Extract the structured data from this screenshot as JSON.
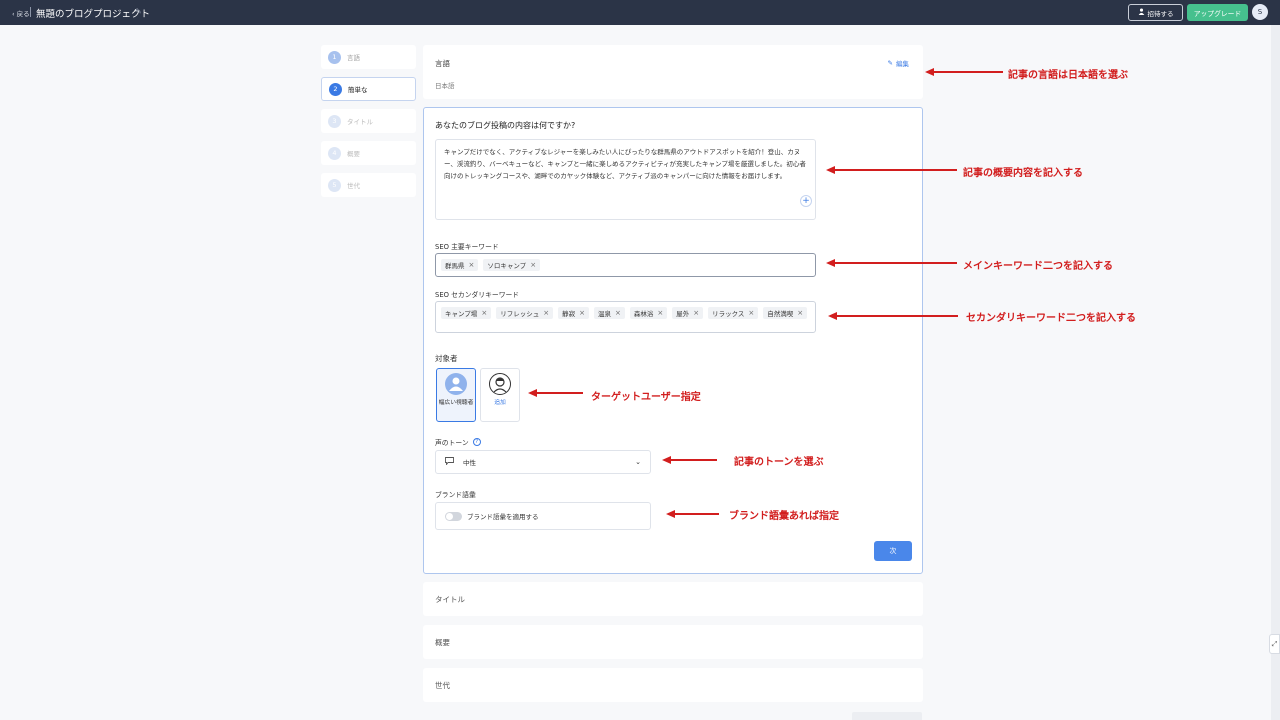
{
  "topbar": {
    "back_label": "‹ 戻る",
    "project_title": "無題のブログプロジェクト",
    "invite_label": "招待する",
    "upgrade_label": "アップグレード",
    "avatar_initial": "S"
  },
  "steps": [
    {
      "num": "1",
      "label": "言語",
      "state": "done"
    },
    {
      "num": "2",
      "label": "簡単な",
      "state": "active"
    },
    {
      "num": "3",
      "label": "タイトル",
      "state": "todo"
    },
    {
      "num": "4",
      "label": "概要",
      "state": "todo"
    },
    {
      "num": "5",
      "label": "世代",
      "state": "todo"
    }
  ],
  "language_card": {
    "label": "言語",
    "value": "日本語",
    "edit_label": "編集"
  },
  "main": {
    "question": "あなたのブログ投稿の内容は何ですか?",
    "description": "キャンプだけでなく、アクティブなレジャーを楽しみたい人にぴったりな群馬県のアウトドアスポットを紹介！登山、カヌー、渓流釣り、バーベキューなど、キャンプと一緒に楽しめるアクティビティが充実したキャンプ場を厳選しました。初心者向けのトレッキングコースや、湖畔でのカヤック体験など、アクティブ派のキャンパーに向けた情報をお届けします。",
    "primary_kw_label": "SEO 主要キーワード",
    "primary_keywords": [
      "群馬県",
      "ソロキャンプ"
    ],
    "secondary_kw_label": "SEO セカンダリキーワード",
    "secondary_keywords": [
      "キャンプ場",
      "リフレッシュ",
      "静寂",
      "温泉",
      "森林浴",
      "屋外",
      "リラックス",
      "自然満喫"
    ],
    "audience_label": "対象者",
    "audience_options": [
      {
        "label": "幅広い視聴者",
        "selected": true
      },
      {
        "label": "追加",
        "selected": false
      }
    ],
    "tone_label": "声のトーン",
    "tone_value": "中性",
    "brand_label": "ブランド語彙",
    "brand_toggle_label": "ブランド語彙を適用する",
    "brand_toggle_on": false,
    "next_label": "次"
  },
  "sections": [
    "タイトル",
    "概要",
    "世代"
  ],
  "annotations": [
    "記事の言語は日本語を選ぶ",
    "記事の概要内容を記入する",
    "メインキーワード二つを記入する",
    "セカンダリキーワード二つを記入する",
    "ターゲットユーザー指定",
    "記事のトーンを選ぶ",
    "ブランド語彙あれば指定"
  ],
  "colors": {
    "topbar": "#2b3447",
    "upgrade": "#46c08e",
    "accent": "#3a7ae4",
    "annotation": "#d21e1e"
  }
}
